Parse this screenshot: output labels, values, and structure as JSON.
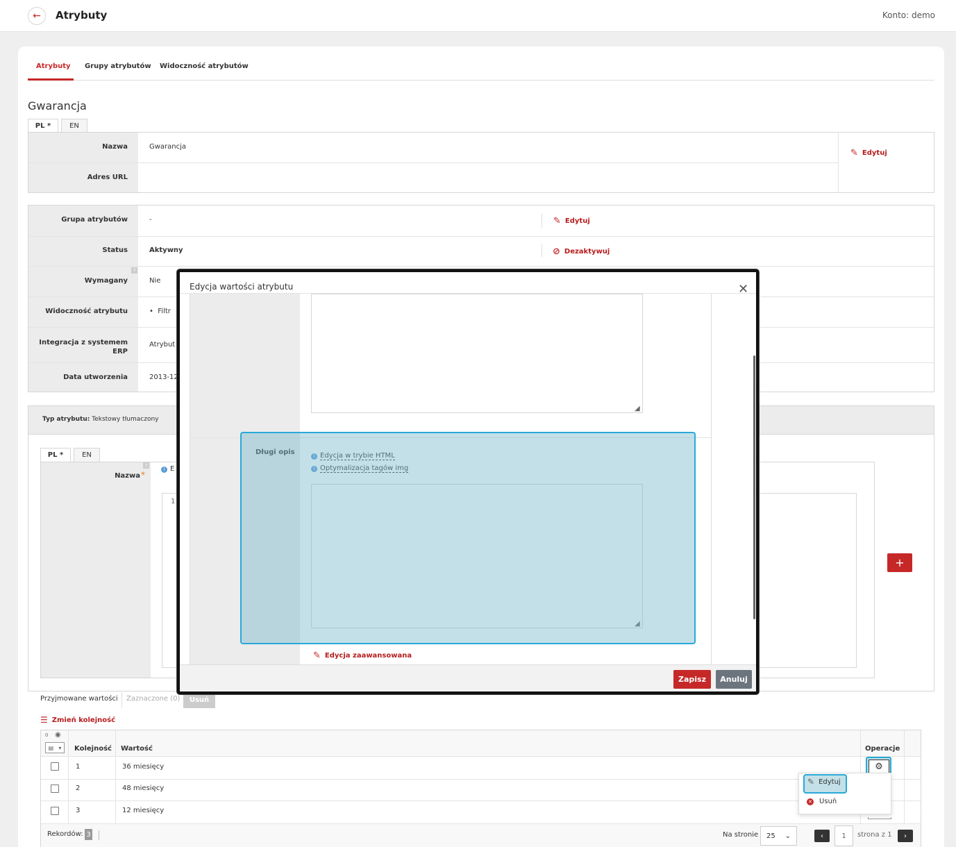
{
  "header": {
    "title": "Atrybuty",
    "account": "Konto: demo"
  },
  "tabs": [
    {
      "label": "Atrybuty"
    },
    {
      "label": "Grupy atrybutów"
    },
    {
      "label": "Widoczność atrybutów"
    }
  ],
  "section_title": "Gwarancja",
  "langs": {
    "pl": "PL *",
    "en": "EN"
  },
  "name_box": {
    "name_label": "Nazwa",
    "name_value": "Gwarancja",
    "url_label": "Adres URL",
    "edit": "Edytuj"
  },
  "details": {
    "group_label": "Grupa atrybutów",
    "group_value": "-",
    "group_edit": "Edytuj",
    "status_label": "Status",
    "status_value": "Aktywny",
    "status_action": "Dezaktywuj",
    "required_label": "Wymagany",
    "required_value": "Nie",
    "visibility_label": "Widoczność atrybutu",
    "visibility_value": "Filtr",
    "erp_label_1": "Integracja z systemem",
    "erp_label_2": "ERP",
    "erp_value": "Atrybut",
    "created_label": "Data utworzenia",
    "created_value": "2013-12"
  },
  "type_bar": {
    "label": "Typ atrybutu:",
    "value": "Tekstowy tłumaczony"
  },
  "values_panel": {
    "name_label": "Nazwa",
    "star": "*",
    "gutter": "1",
    "info_stub": "E"
  },
  "modal": {
    "title": "Edycja wartości atrybutu",
    "long_desc_label": "Długi opis",
    "html_mode": "Edycja w trybie HTML",
    "img_opt": "Optymalizacja tagów img",
    "advanced": "Edycja zaawansowana",
    "save": "Zapisz",
    "cancel": "Anuluj"
  },
  "filters": {
    "accepted": "Przyjmowane wartości",
    "selected": "Zaznaczone (0)",
    "delete": "Usuń"
  },
  "reorder": "Zmień kolejność",
  "table": {
    "cols": {
      "order": "Kolejność",
      "value": "Wartość",
      "ops": "Operacje",
      "count_zero": "0"
    },
    "rows": [
      {
        "order": "1",
        "value": "36 miesięcy"
      },
      {
        "order": "2",
        "value": "48 miesięcy"
      },
      {
        "order": "3",
        "value": "12 miesięcy"
      }
    ]
  },
  "dropdown": {
    "edit": "Edytuj",
    "delete": "Usuń"
  },
  "footer": {
    "records_label": "Rekordów:",
    "records": "3",
    "per_page_label": "Na stronie",
    "per_page": "25",
    "page": "1",
    "page_of": "strona z 1"
  }
}
